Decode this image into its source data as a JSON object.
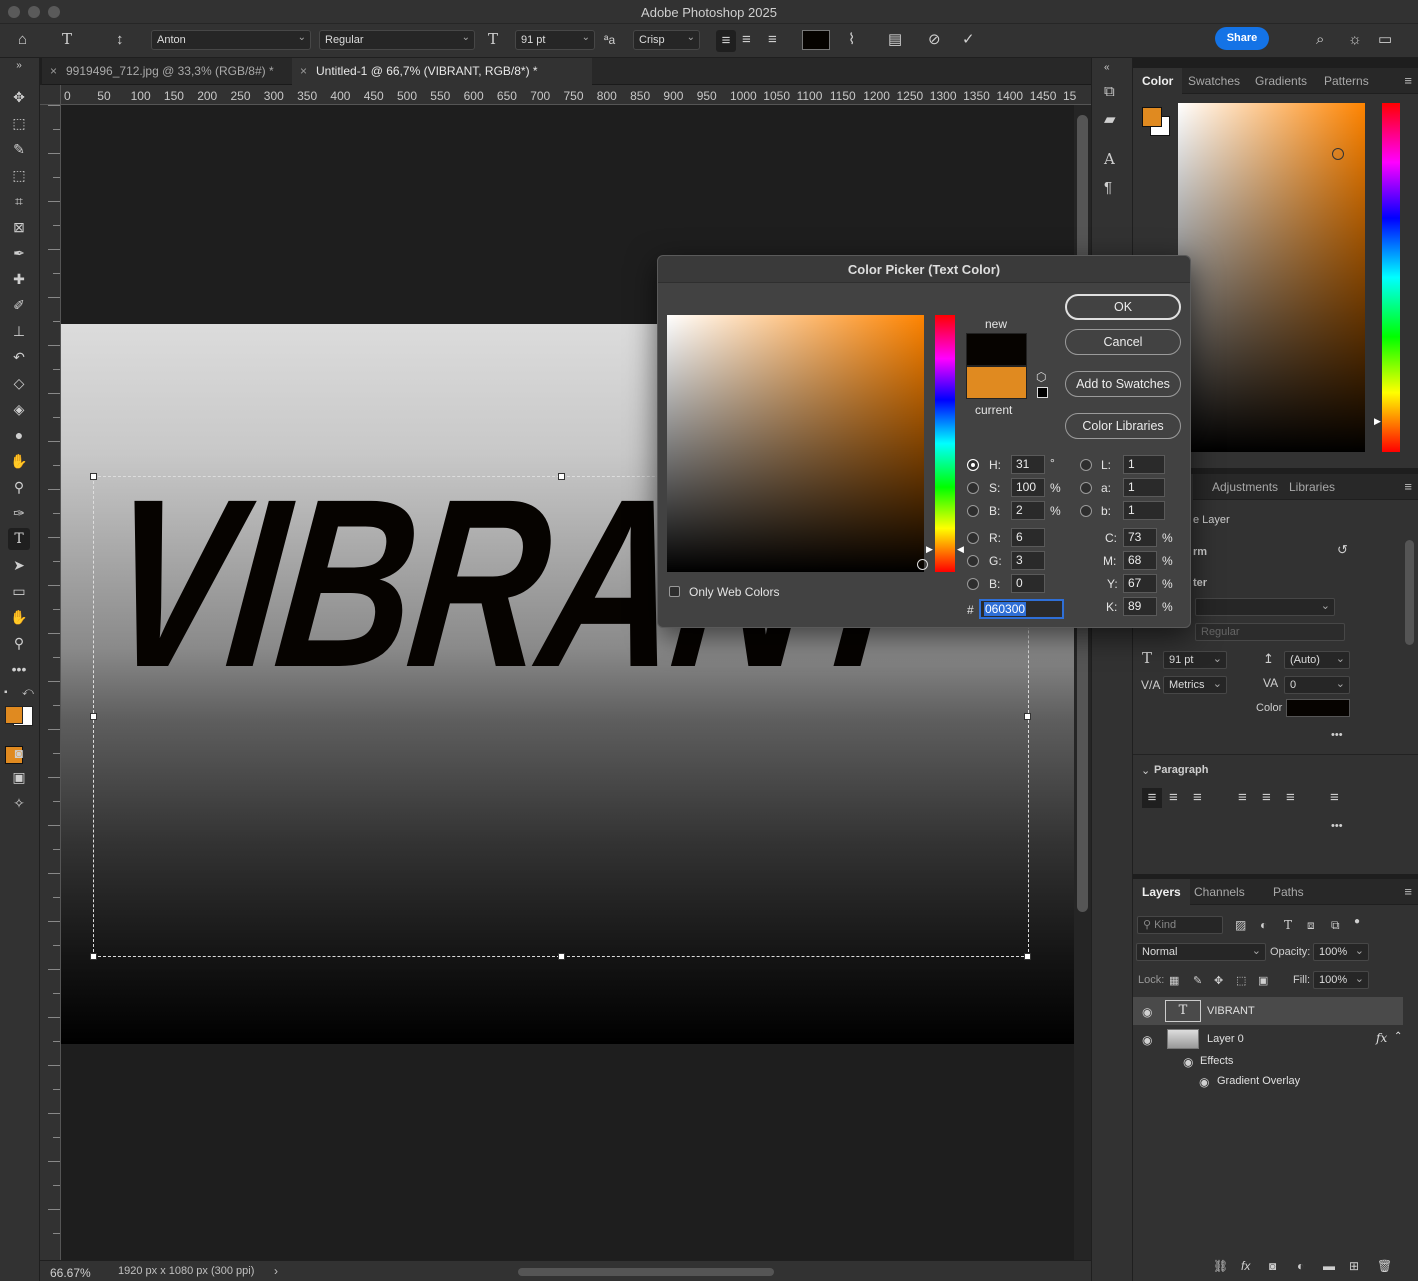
{
  "app": {
    "title": "Adobe Photoshop 2025",
    "share_label": "Share"
  },
  "options": {
    "font_family": "Anton",
    "font_style": "Regular",
    "font_size": "91 pt",
    "antialias": "Crisp",
    "text_color": "#060300"
  },
  "tabs": [
    {
      "label": "9919496_712.jpg @ 33,3% (RGB/8#) *",
      "close": "×"
    },
    {
      "label": "Untitled-1 @ 66,7% (VIBRANT, RGB/8*) *",
      "close": "×"
    }
  ],
  "ruler": {
    "h": [
      "0",
      "50",
      "100",
      "150",
      "200",
      "250",
      "300",
      "350",
      "400",
      "450",
      "500",
      "550",
      "600",
      "650",
      "700",
      "750",
      "800",
      "850",
      "900",
      "950",
      "1000",
      "1050",
      "1100",
      "1150",
      "1200",
      "1250",
      "1300",
      "1350",
      "1400",
      "1450",
      "15"
    ]
  },
  "canvas": {
    "text": "VIBRANT"
  },
  "status": {
    "zoom": "66.67%",
    "doc": "1920 px x 1080 px (300 ppi)",
    "arrow": "›"
  },
  "dialog": {
    "title": "Color Picker (Text Color)",
    "new_label": "new",
    "current_label": "current",
    "new_color": "#060300",
    "current_color": "#e08a20",
    "buttons": {
      "ok": "OK",
      "cancel": "Cancel",
      "add": "Add to Swatches",
      "libraries": "Color Libraries"
    },
    "web_colors": "Only Web Colors",
    "fields": {
      "H": {
        "label": "H:",
        "value": "31",
        "unit": "°"
      },
      "S": {
        "label": "S:",
        "value": "100",
        "unit": "%"
      },
      "Bv": {
        "label": "B:",
        "value": "2",
        "unit": "%"
      },
      "R": {
        "label": "R:",
        "value": "6"
      },
      "G": {
        "label": "G:",
        "value": "3"
      },
      "B": {
        "label": "B:",
        "value": "0"
      },
      "L": {
        "label": "L:",
        "value": "1"
      },
      "a": {
        "label": "a:",
        "value": "1"
      },
      "b": {
        "label": "b:",
        "value": "1"
      },
      "C": {
        "label": "C:",
        "value": "73",
        "unit": "%"
      },
      "M": {
        "label": "M:",
        "value": "68",
        "unit": "%"
      },
      "Y": {
        "label": "Y:",
        "value": "67",
        "unit": "%"
      },
      "K": {
        "label": "K:",
        "value": "89",
        "unit": "%"
      }
    },
    "hex_label": "#",
    "hex": "060300"
  },
  "color_panel": {
    "tabs": [
      "Color",
      "Swatches",
      "Gradients",
      "Patterns"
    ],
    "fg": "#e08a20",
    "bg": "#ffffff"
  },
  "properties": {
    "tabs": [
      "s",
      "Adjustments",
      "Libraries"
    ],
    "layer_type": "e Layer",
    "transform": "rm",
    "character": "ter",
    "font_style": "Regular",
    "size": "91 pt",
    "leading": "(Auto)",
    "kerning": "Metrics",
    "tracking": "0",
    "color_label": "Color",
    "more": "•••",
    "paragraph": "Paragraph"
  },
  "layers": {
    "tabs": [
      "Layers",
      "Channels",
      "Paths"
    ],
    "kind": "Kind",
    "blend": "Normal",
    "opacity_label": "Opacity:",
    "opacity": "100%",
    "lock_label": "Lock:",
    "fill_label": "Fill:",
    "fill": "100%",
    "items": [
      {
        "name": "VIBRANT",
        "thumb": "T"
      },
      {
        "name": "Layer 0",
        "fx": "fx"
      }
    ],
    "effects": "Effects",
    "gradient_overlay": "Gradient Overlay"
  }
}
